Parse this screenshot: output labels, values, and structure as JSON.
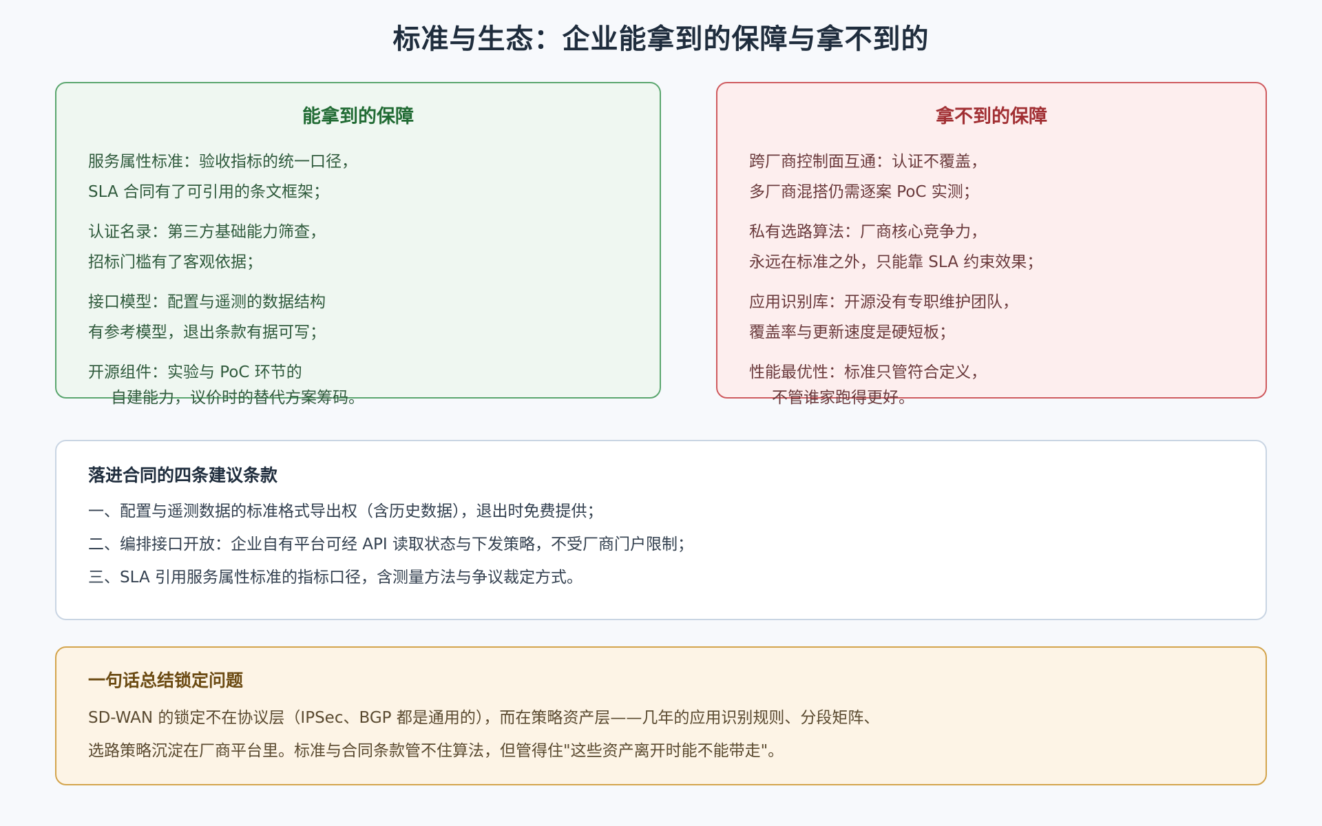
{
  "page": {
    "title": "标准与生态：企业能拿到的保障与拿不到的"
  },
  "can_get": {
    "title": "能拿到的保障",
    "items": [
      {
        "line1": "服务属性标准：验收指标的统一口径，",
        "line2": "SLA 合同有了可引用的条文框架；"
      },
      {
        "line1": "认证名录：第三方基础能力筛查，",
        "line2": "招标门槛有了客观依据；"
      },
      {
        "line1": "接口模型：配置与遥测的数据结构",
        "line2": "有参考模型，退出条款有据可写；"
      },
      {
        "line1": "开源组件：实验与 PoC 环节的",
        "line2": "自建能力，议价时的替代方案筹码。"
      }
    ]
  },
  "cannot_get": {
    "title": "拿不到的保障",
    "items": [
      {
        "line1": "跨厂商控制面互通：认证不覆盖，",
        "line2": "多厂商混搭仍需逐案 PoC 实测；"
      },
      {
        "line1": "私有选路算法：厂商核心竞争力，",
        "line2": "永远在标准之外，只能靠 SLA 约束效果；"
      },
      {
        "line1": "应用识别库：开源没有专职维护团队，",
        "line2": "覆盖率与更新速度是硬短板；"
      },
      {
        "line1": "性能最优性：标准只管符合定义，",
        "line2": "不管谁家跑得更好。"
      }
    ]
  },
  "contract": {
    "title": "落进合同的四条建议条款",
    "clauses": [
      "一、配置与遥测数据的标准格式导出权（含历史数据），退出时免费提供；",
      "二、编排接口开放：企业自有平台可经 API 读取状态与下发策略，不受厂商门户限制；",
      "三、SLA 引用服务属性标准的指标口径，含测量方法与争议裁定方式。"
    ]
  },
  "summary": {
    "title": "一句话总结锁定问题",
    "lines": [
      "SD-WAN 的锁定不在协议层（IPSec、BGP 都是通用的），而在策略资产层——几年的应用识别规则、分段矩阵、",
      "选路策略沉淀在厂商平台里。标准与合同条款管不住算法，但管得住\"这些资产离开时能不能带走\"。"
    ]
  },
  "colors": {
    "green_border": "#5aa66e",
    "red_border": "#cf5a5e",
    "yellow_border": "#d3a44c"
  }
}
